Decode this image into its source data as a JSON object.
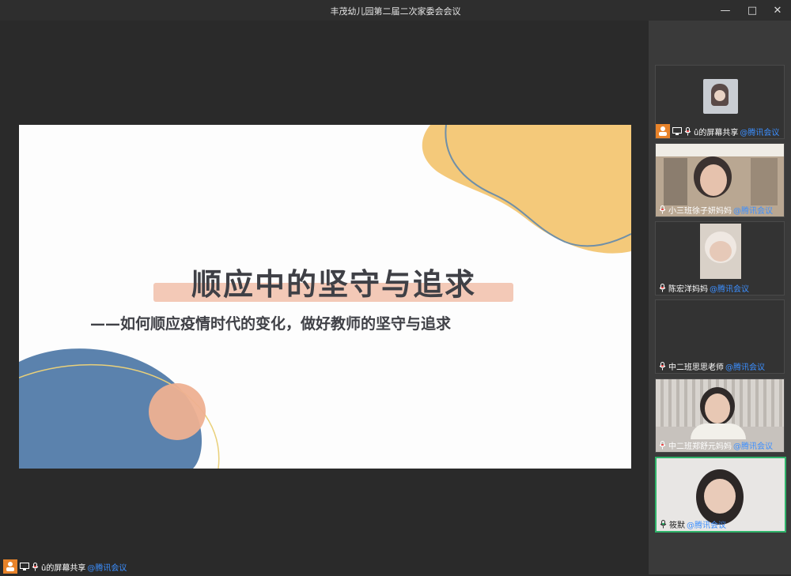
{
  "window": {
    "title": "丰茂幼儿园第二届二次家委会会议",
    "controls": {
      "minimize": "—",
      "maximize": "□",
      "close": "✕"
    }
  },
  "slide": {
    "title": "顺应中的坚守与追求",
    "subtitle": "——如何顺应疫情时代的变化，做好教师的坚守与追求",
    "colors": {
      "yellow": "#f4c97a",
      "blue": "#5b82ad",
      "peach": "#eeb091",
      "highlight": "#f3c9b7"
    }
  },
  "participants": [
    {
      "name": "û的屏幕共享",
      "tag": "@腾讯会议",
      "icons": [
        "share-icon",
        "screen-icon",
        "mic-icon"
      ]
    },
    {
      "name": "小三班徐子妍妈妈",
      "tag": "@腾讯会议",
      "icons": [
        "mic-icon"
      ]
    },
    {
      "name": "陈宏洋妈妈",
      "tag": "@腾讯会议",
      "icons": [
        "mic-icon"
      ]
    },
    {
      "name": "中二班思思老师",
      "tag": "@腾讯会议",
      "icons": [
        "mic-icon"
      ]
    },
    {
      "name": "中二班郑舒元妈妈",
      "tag": "@腾讯会议",
      "icons": [
        "mic-icon"
      ]
    },
    {
      "name": "筱默",
      "tag": "@腾讯会议",
      "icons": [
        "mic-icon"
      ],
      "active_speaker": true
    }
  ],
  "bottom": {
    "name": "û的屏幕共享",
    "tag": "@腾讯会议"
  }
}
